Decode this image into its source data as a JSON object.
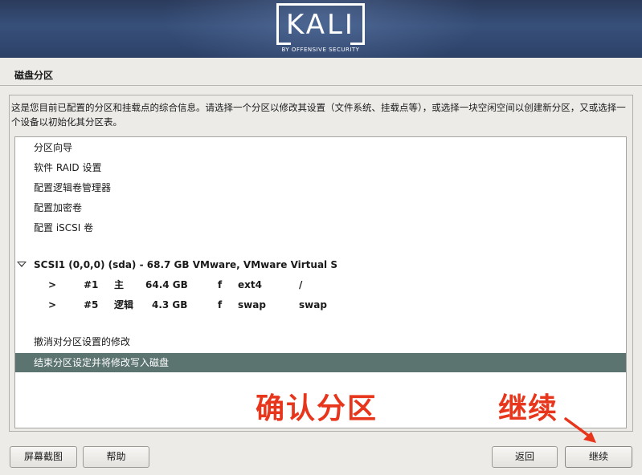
{
  "banner": {
    "logo_text": "KALI",
    "logo_subtitle": "BY OFFENSIVE SECURITY"
  },
  "page": {
    "title": "磁盘分区",
    "description": "这是您目前已配置的分区和挂载点的综合信息。请选择一个分区以修改其设置（文件系统、挂载点等），或选择一块空闲空间以创建新分区，又或选择一个设备以初始化其分区表。"
  },
  "list": {
    "tools": [
      {
        "label": "分区向导"
      },
      {
        "label": "软件 RAID 设置"
      },
      {
        "label": "配置逻辑卷管理器"
      },
      {
        "label": "配置加密卷"
      },
      {
        "label": "配置 iSCSI 卷"
      }
    ],
    "disk": {
      "label": "SCSI1 (0,0,0) (sda) - 68.7 GB VMware, VMware Virtual S"
    },
    "partitions": [
      {
        "arrow": ">",
        "num": "#1",
        "type": "主",
        "size": "64.4 GB",
        "flag": "f",
        "fs": "ext4",
        "mount": "/"
      },
      {
        "arrow": ">",
        "num": "#5",
        "type": "逻辑",
        "size": "4.3 GB",
        "flag": "f",
        "fs": "swap",
        "mount": "swap"
      }
    ],
    "actions": [
      {
        "label": "撤消对分区设置的修改"
      },
      {
        "label": "结束分区设定并将修改写入磁盘"
      }
    ]
  },
  "annotations": {
    "confirm": "确认分区",
    "continue": "继续"
  },
  "buttons": {
    "screenshot": "屏幕截图",
    "help": "帮助",
    "back": "返回",
    "continue": "继续"
  },
  "colors": {
    "selected_row": "#5b7470",
    "annotation": "#e8361c",
    "banner": "#2f4468"
  }
}
